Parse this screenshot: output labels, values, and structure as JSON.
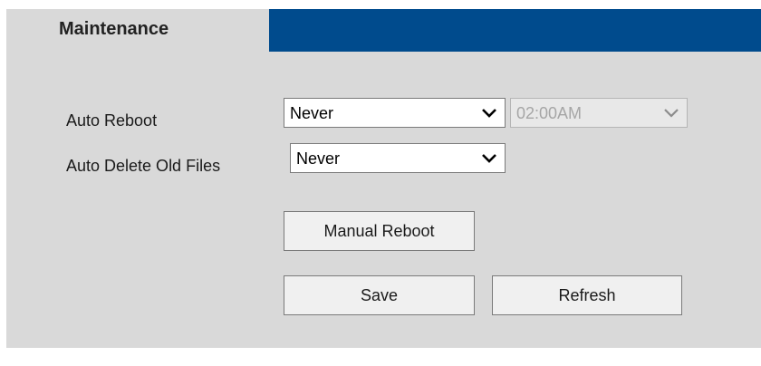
{
  "header": {
    "title": "Maintenance",
    "bar_color": "#004b8d"
  },
  "auto_reboot": {
    "label": "Auto Reboot",
    "frequency_value": "Never",
    "time_value": "02:00AM",
    "time_disabled": true
  },
  "auto_delete": {
    "label": "Auto Delete Old Files",
    "value": "Never"
  },
  "buttons": {
    "manual_reboot": "Manual Reboot",
    "save": "Save",
    "refresh": "Refresh"
  },
  "icons": {
    "dropdown": "chevron-down-icon"
  }
}
